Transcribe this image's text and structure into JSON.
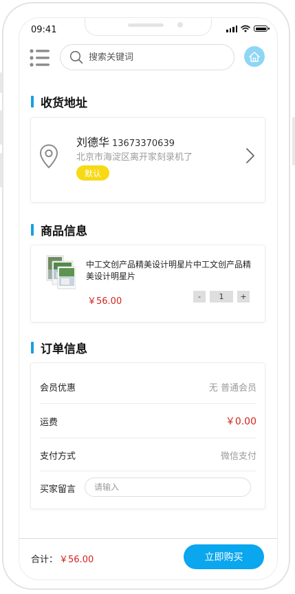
{
  "status_bar": {
    "time": "09:41"
  },
  "search": {
    "placeholder": "搜索关键词"
  },
  "sections": {
    "address_title": "收货地址",
    "goods_title": "商品信息",
    "order_title": "订单信息"
  },
  "address": {
    "name": "刘德华",
    "phone": "13673370639",
    "detail": "北京市海淀区离开家刻录机了",
    "default_tag": "默认"
  },
  "goods": {
    "name": "中工文创产品精美设计明星片中工文创产品精美设计明星片",
    "price": "￥56.00",
    "quantity": "1",
    "minus": "-",
    "plus": "+"
  },
  "order": {
    "member_label": "会员优惠",
    "member_value": "无 普通会员",
    "shipping_label": "运费",
    "shipping_value": "￥0.00",
    "payment_label": "支付方式",
    "payment_value": "微信支付",
    "remark_label": "买家留言",
    "remark_placeholder": "请输入"
  },
  "footer": {
    "total_label": "合计：",
    "total_value": "￥56.00",
    "buy_label": "立即购买"
  },
  "colors": {
    "accent": "#1a9ee0",
    "button": "#0aa6ee",
    "price": "#d0241c",
    "tag": "#f7d916"
  },
  "icons": [
    "menu-icon",
    "search-icon",
    "home-icon",
    "location-pin-icon",
    "chevron-right-icon"
  ]
}
